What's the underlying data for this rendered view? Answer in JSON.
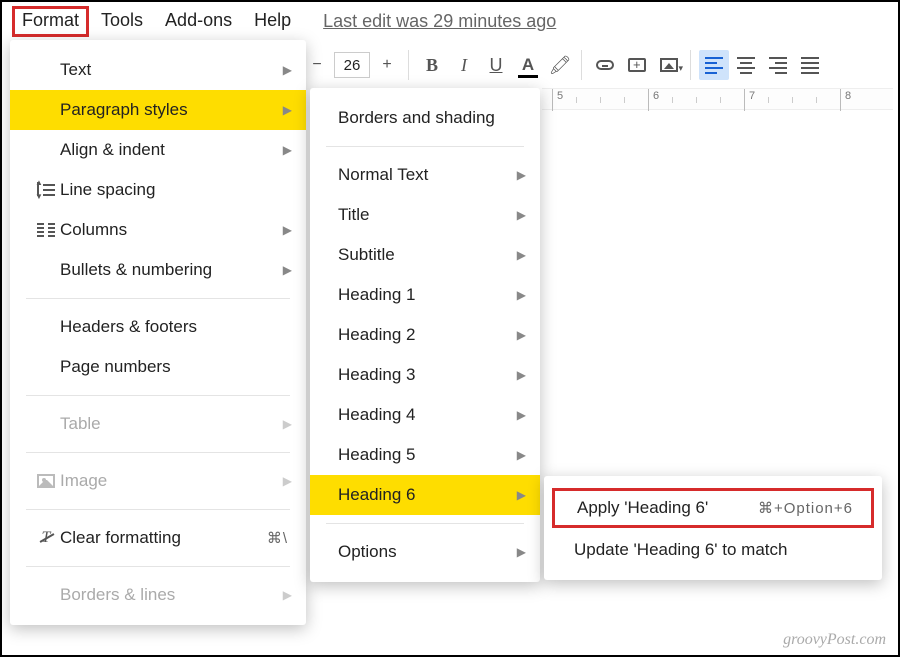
{
  "menubar": {
    "items": [
      "Format",
      "Tools",
      "Add-ons",
      "Help"
    ],
    "last_edit": "Last edit was 29 minutes ago"
  },
  "toolbar": {
    "font_size": "26",
    "minus": "−",
    "plus": "+",
    "bold": "B",
    "italic": "I",
    "underline": "U",
    "textcolor": "A",
    "highlight": "🖍"
  },
  "ruler": {
    "numbers": [
      "5",
      "6",
      "7",
      "8"
    ]
  },
  "menu1": {
    "items": [
      {
        "label": "Text"
      },
      {
        "label": "Paragraph styles"
      },
      {
        "label": "Align & indent"
      },
      {
        "label": "Line spacing"
      },
      {
        "label": "Columns"
      },
      {
        "label": "Bullets & numbering"
      },
      {
        "label": "Headers & footers"
      },
      {
        "label": "Page numbers"
      },
      {
        "label": "Table"
      },
      {
        "label": "Image"
      },
      {
        "label": "Clear formatting",
        "shortcut": "⌘\\"
      },
      {
        "label": "Borders & lines"
      }
    ]
  },
  "menu2": {
    "items": [
      {
        "label": "Borders and shading"
      },
      {
        "label": "Normal Text"
      },
      {
        "label": "Title"
      },
      {
        "label": "Subtitle"
      },
      {
        "label": "Heading 1"
      },
      {
        "label": "Heading 2"
      },
      {
        "label": "Heading 3"
      },
      {
        "label": "Heading 4"
      },
      {
        "label": "Heading 5"
      },
      {
        "label": "Heading 6"
      },
      {
        "label": "Options"
      }
    ]
  },
  "menu3": {
    "items": [
      {
        "label": "Apply 'Heading 6'",
        "shortcut": "⌘+Option+6"
      },
      {
        "label": "Update 'Heading 6' to match"
      }
    ]
  },
  "watermark": "groovyPost.com"
}
